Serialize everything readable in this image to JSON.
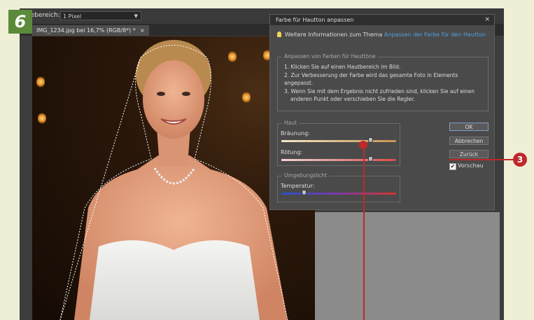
{
  "step_badge": "6",
  "callout_number": "3",
  "options_bar": {
    "brush_label": "nebereich:",
    "brush_value": "1 Pixel"
  },
  "document_tab": {
    "title": "IMG_1234.jpg bei 16,7% (RGB/8*) *",
    "close": "×"
  },
  "dialog": {
    "title": "Farbe für Hautton anpassen",
    "close": "×",
    "info_text": "Weitere Informationen zum Thema",
    "info_link": "Anpassen der Farbe für den Hautton",
    "instructions": {
      "title": "Anpassen von Farben für Hauttöne",
      "lines": [
        "1. Klicken Sie auf einen Hautbereich im Bild.",
        "2. Zur Verbesserung der Farbe wird das gesamte Foto in Elements angepasst.",
        "3. Wenn Sie mit dem Ergebnis nicht zufrieden sind, klicken Sie auf einen",
        "    anderen Punkt oder verschieben Sie die Regler."
      ]
    },
    "skin_group": {
      "title": "Haut",
      "tan_label": "Bräunung:",
      "tan_value": 0.78,
      "blush_label": "Rötung:",
      "blush_value": 0.78
    },
    "light_group": {
      "title": "Umgebungslicht",
      "temperature_label": "Temperatur:",
      "temperature_value": 0.2
    },
    "buttons": {
      "ok": "OK",
      "cancel": "Abbrechen",
      "back": "Zurück"
    },
    "preview_label": "Vorschau",
    "preview_checked": true
  },
  "colors": {
    "callout": "#c0282a",
    "badge": "#5b8a3a",
    "link": "#4fa0e0"
  }
}
